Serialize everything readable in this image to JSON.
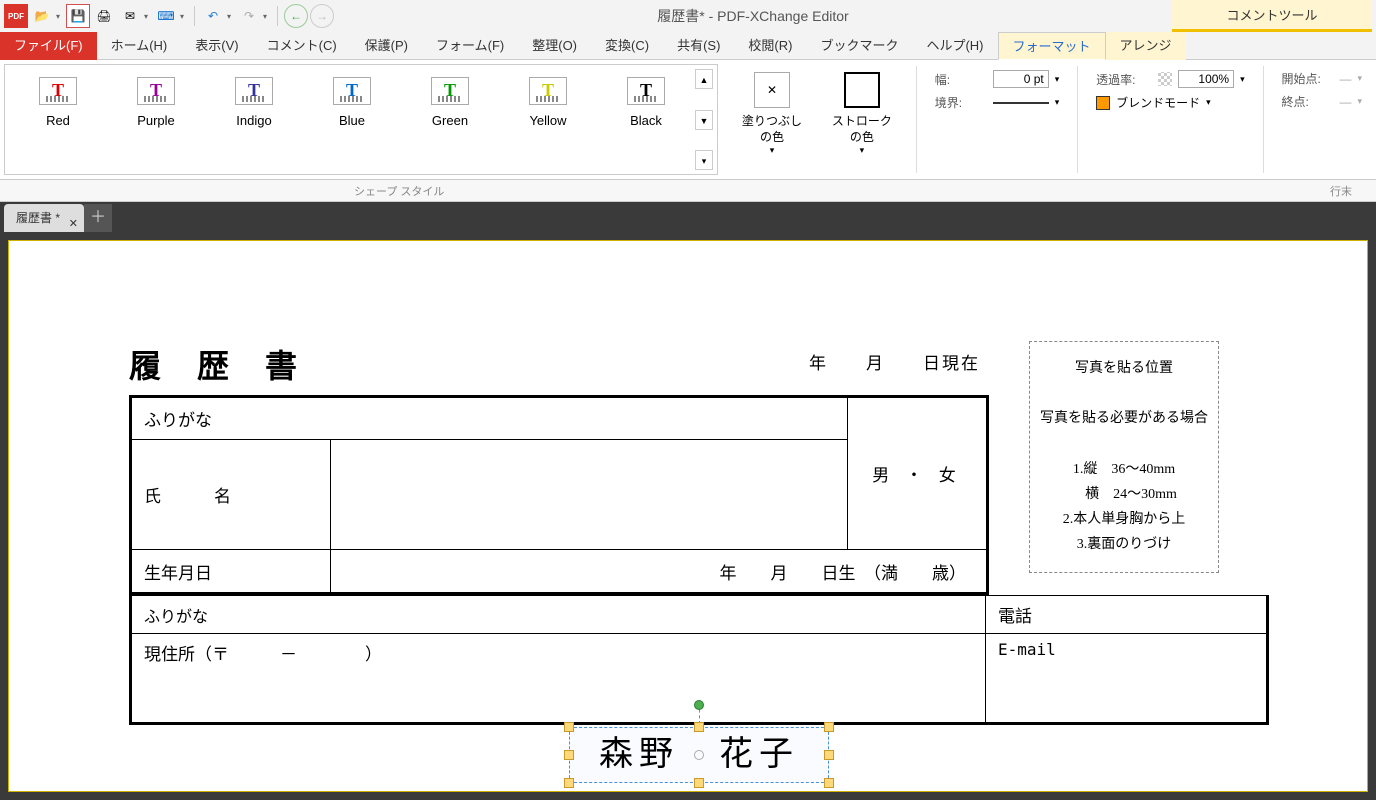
{
  "title": "履歴書* - PDF-XChange Editor",
  "contextual_group": "コメントツール",
  "menu": [
    "ファイル(F)",
    "ホーム(H)",
    "表示(V)",
    "コメント(C)",
    "保護(P)",
    "フォーム(F)",
    "整理(O)",
    "変換(C)",
    "共有(S)",
    "校閲(R)",
    "ブックマーク",
    "ヘルプ(H)",
    "フォーマット",
    "アレンジ"
  ],
  "styles": [
    {
      "name": "Red",
      "cls": "red"
    },
    {
      "name": "Purple",
      "cls": "purple"
    },
    {
      "name": "Indigo",
      "cls": "indigo"
    },
    {
      "name": "Blue",
      "cls": "blue"
    },
    {
      "name": "Green",
      "cls": "green"
    },
    {
      "name": "Yellow",
      "cls": "yellow"
    },
    {
      "name": "Black",
      "cls": "black"
    }
  ],
  "fill": {
    "label": "塗りつぶしの色"
  },
  "stroke": {
    "label": "ストロークの色"
  },
  "width": {
    "label": "幅:",
    "value": "0 pt"
  },
  "border": {
    "label": "境界:"
  },
  "opacity": {
    "label": "透過率:",
    "value": "100%"
  },
  "blend": {
    "label": "ブレンドモード"
  },
  "start": {
    "label": "開始点:"
  },
  "end": {
    "label": "終点:"
  },
  "group_caption": "シェープ スタイル",
  "line_end_caption": "行末",
  "doctab": "履歴書 *",
  "resume": {
    "title": "履歴書",
    "date_row": "年　　月　　日現在",
    "furigana": "ふりがな",
    "name_label": "氏　名",
    "name_value": "森野　花子",
    "gender": "男 ・ 女",
    "birthday_label": "生年月日",
    "birthday_row": "年　　月　　日生　（満　　歳）",
    "address_furigana": "ふりがな",
    "phone": "電話",
    "address_label": "現住所（〒　　　－　　　　）",
    "email": "E-mail",
    "photo": {
      "title": "写真を貼る位置",
      "line1": "写真を貼る必要がある場合",
      "line2": "1.縦　36～40mm",
      "line3": "　横　24～30mm",
      "line4": "2.本人単身胸から上",
      "line5": "3.裏面のりづけ"
    }
  }
}
